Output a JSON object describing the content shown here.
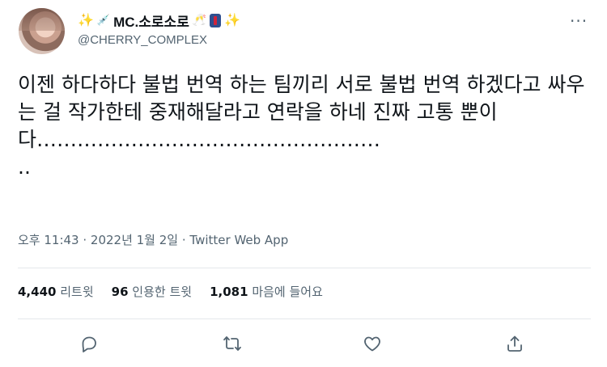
{
  "author": {
    "display_name": "MC.소로소로",
    "handle": "@CHERRY_COMPLEX"
  },
  "tweet": {
    "text": "이젠 하다하다 불법 번역 하는 팀끼리 서로 불법 번역 하겠다고 싸우는 걸 작가한테 중재해달라고 연락을 하네 진짜 고통 뿐이\n다……………………………………………\n..",
    "timestamp": "오후 11:43 · 2022년 1월 2일 · Twitter Web App"
  },
  "stats": {
    "retweets_count": "4,440",
    "retweets_label": "리트윗",
    "quotes_count": "96",
    "quotes_label": "인용한 트윗",
    "likes_count": "1,081",
    "likes_label": "마음에 들어요"
  },
  "icons": {
    "avatar": "profile-avatar",
    "more": "more-icon",
    "reply": "reply-icon",
    "retweet": "retweet-icon",
    "like": "heart-icon",
    "share": "share-icon"
  },
  "colors": {
    "text": "#0f1419",
    "secondary": "#536471",
    "divider": "#e4e8eb"
  }
}
